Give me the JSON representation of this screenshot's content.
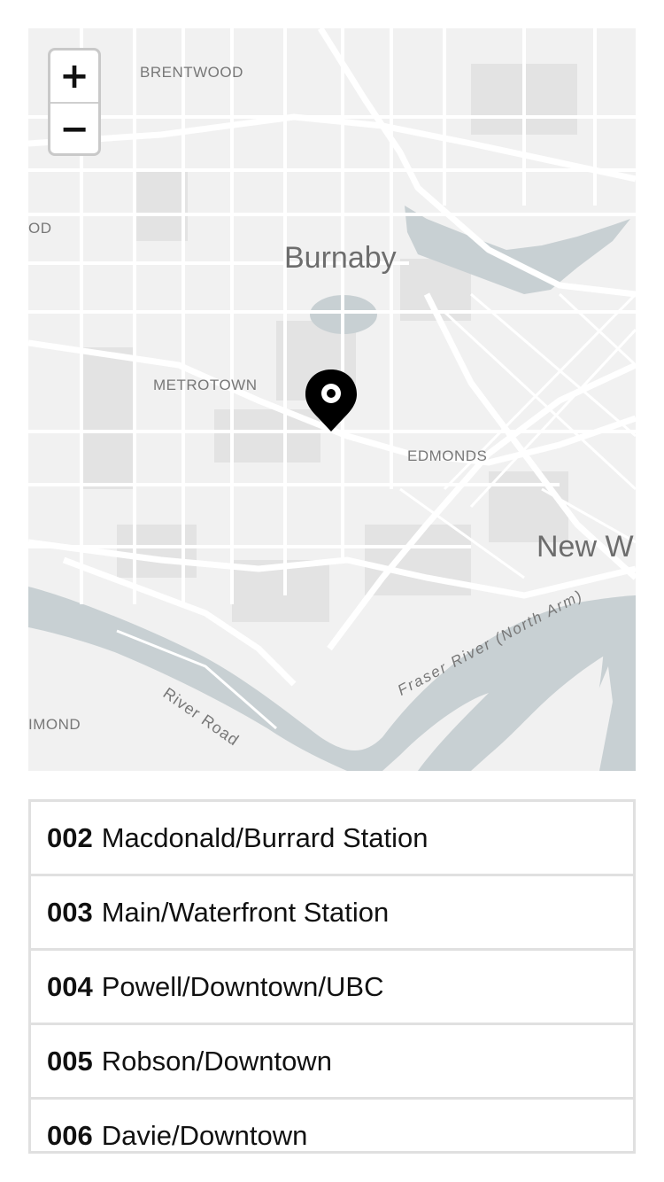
{
  "map": {
    "zoom_in_label": "+",
    "zoom_out_label": "−",
    "labels": {
      "brentwood": "BRENTWOOD",
      "od": "OD",
      "burnaby": "Burnaby",
      "metrotown": "METROTOWN",
      "edmonds": "EDMONDS",
      "new_westminster": "New W",
      "river_road": "River Road",
      "fraser_river": "Fraser River (North Arm)",
      "richmond": "IMOND"
    },
    "colors": {
      "land": "#f1f1f1",
      "water": "#c8d0d3",
      "road": "#ffffff",
      "block": "#e4e4e4",
      "marker": "#000000"
    },
    "marker_icon": "map-pin-icon"
  },
  "routes": [
    {
      "number": "002",
      "name": "Macdonald/Burrard Station"
    },
    {
      "number": "003",
      "name": "Main/Waterfront Station"
    },
    {
      "number": "004",
      "name": "Powell/Downtown/UBC"
    },
    {
      "number": "005",
      "name": "Robson/Downtown"
    },
    {
      "number": "006",
      "name": "Davie/Downtown"
    }
  ]
}
